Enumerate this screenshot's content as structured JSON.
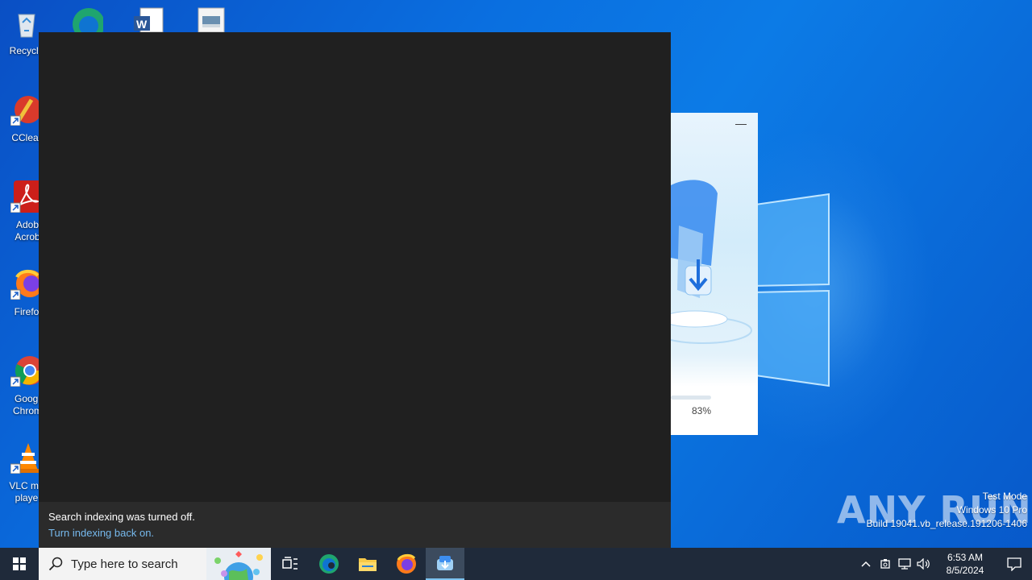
{
  "desktop": {
    "icons": [
      {
        "label": "Recycle",
        "icon": "recycle-bin-icon"
      },
      {
        "label": "CClear",
        "icon": "ccleaner-icon"
      },
      {
        "label": "Adob Acrob",
        "icon": "acrobat-icon"
      },
      {
        "label": "Firefo",
        "icon": "firefox-icon"
      },
      {
        "label": "Googl Chrom",
        "icon": "chrome-icon"
      },
      {
        "label": "VLC me playe",
        "icon": "vlc-icon"
      }
    ]
  },
  "installer": {
    "minimize_label": "—",
    "progress_text": "83%",
    "progress_fraction": 0.83
  },
  "search_panel": {
    "notice_title": "Search indexing was turned off.",
    "notice_link": "Turn indexing back on."
  },
  "watermark": {
    "brand": "ANY RUN",
    "line1": "Test Mode",
    "line2": "Windows 10 Pro",
    "line3": "Build 19041.vb_release.191206-1406"
  },
  "taskbar": {
    "search_placeholder": "Type here to search",
    "apps": [
      "task-view-icon",
      "edge-icon",
      "file-explorer-icon",
      "firefox-icon",
      "installer-app-icon"
    ],
    "clock_time": "6:53 AM",
    "clock_date": "8/5/2024"
  },
  "colors": {
    "taskbar": "#1f2a3a",
    "search_panel": "#202020",
    "link": "#76b9ed"
  }
}
